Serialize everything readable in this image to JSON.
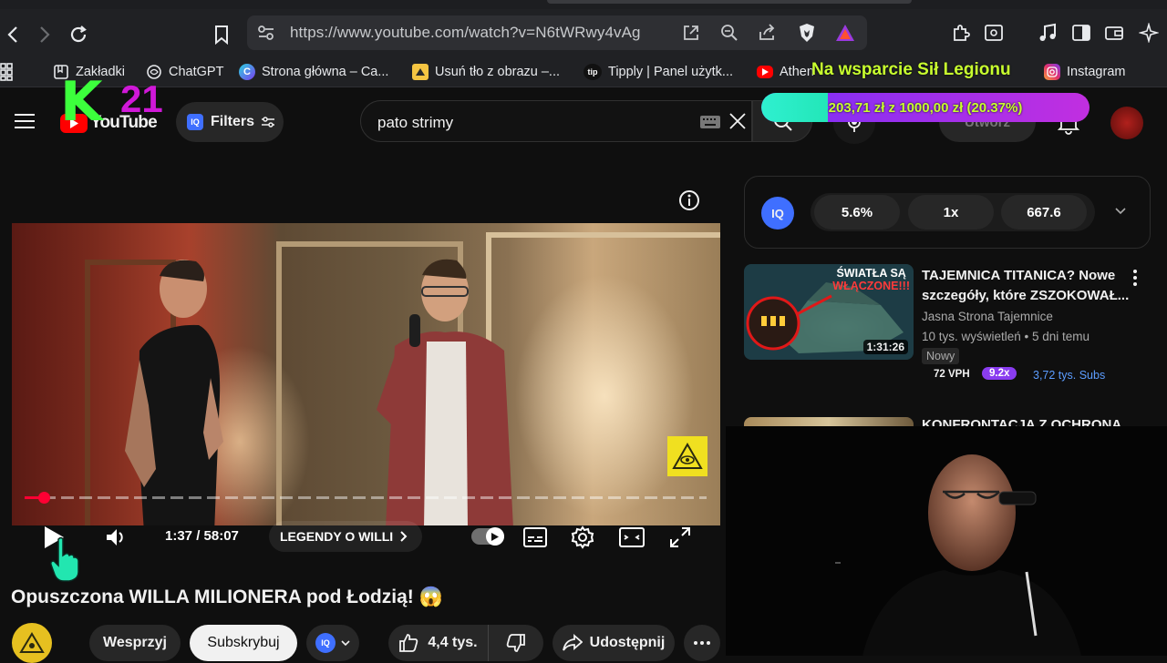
{
  "browser": {
    "url": "https://www.youtube.com/watch?v=N6tWRwy4vAg",
    "bookmarks": [
      {
        "label": "Zakładki",
        "icon": "bookmark-folder-icon"
      },
      {
        "label": "ChatGPT",
        "icon": "chatgpt-icon"
      },
      {
        "label": "Strona główna – Ca...",
        "icon": "canva-icon"
      },
      {
        "label": "Usuń tło z obrazu –...",
        "icon": "remove-bg-icon"
      },
      {
        "label": "Tipply | Panel użytk...",
        "icon": "tipply-icon"
      },
      {
        "label": "Athen",
        "icon": "youtube-icon"
      },
      {
        "label": "Instagram",
        "icon": "instagram-icon"
      }
    ]
  },
  "overlay": {
    "logo_letter": "K",
    "logo_number": "21",
    "donation_title": "Na wsparcie Sił Legionu",
    "donation_progress": "203,71 zł z 1000,00 zł (20.37%)",
    "donation_fraction": 0.2037
  },
  "masthead": {
    "logo_text": "YouTube",
    "filters_label": "Filters",
    "iq_text": "IQ",
    "search_query": "pato strimy",
    "create_label": "Utwórz"
  },
  "player": {
    "time": "1:37 / 58:07",
    "chapter": "LEGENDY O WILLI",
    "progress_fraction": 0.028
  },
  "video": {
    "title": "Opuszczona WILLA MILIONERA pod Łodzią! 😱",
    "support_label": "Wesprzyj",
    "subscribe_label": "Subskrybuj",
    "likes": "4,4 tys.",
    "share_label": "Udostępnij"
  },
  "iq_panel": {
    "stats": [
      "5.6%",
      "1x",
      "667.6"
    ]
  },
  "recommendations": [
    {
      "title_line1": "TAJEMNICA TITANICA? Nowe",
      "title_line2": "szczegóły, które ZSZOKOWAŁ...",
      "channel": "Jasna Strona Tajemnice",
      "meta": "10 tys. wyświetleń • 5 dni temu",
      "badge": "Nowy",
      "duration": "1:31:26",
      "thumb_text_line1": "ŚWIATŁA SĄ",
      "thumb_text_line2": "WŁĄCZONE!!!",
      "vph": "72 VPH",
      "multiplier": "9.2x",
      "subs": "3,72 tys. Subs"
    },
    {
      "title_line1": "KONFRONTACJA Z OCHRONĄ"
    }
  ]
}
